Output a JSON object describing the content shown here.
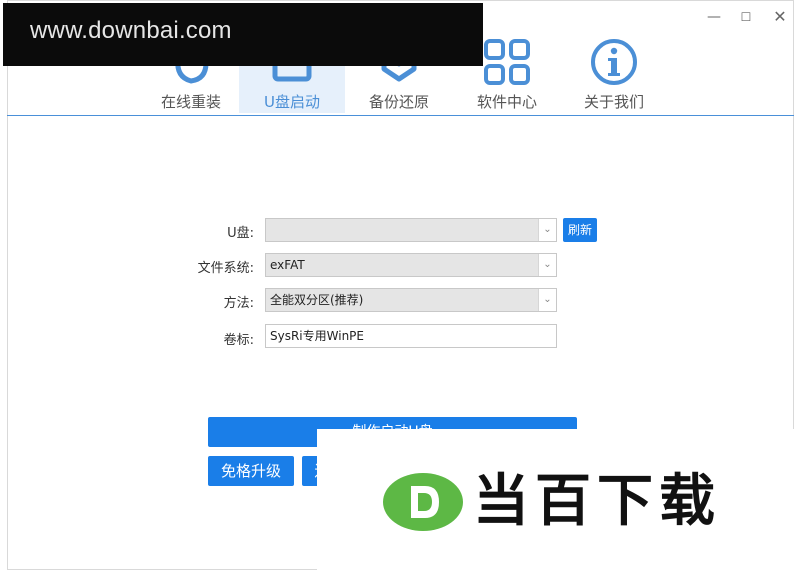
{
  "watermark_top": "www.downbai.com",
  "watermark_bottom": {
    "text": "当百下载"
  },
  "window_controls": {
    "min": "—",
    "max": "☐",
    "close": "✕"
  },
  "nav": {
    "items": [
      {
        "label": "在线重装",
        "icon": "cursor-hand-icon",
        "active": false
      },
      {
        "label": "U盘启动",
        "icon": "usb-drive-icon",
        "active": true
      },
      {
        "label": "备份还原",
        "icon": "backup-box-icon",
        "active": false
      },
      {
        "label": "软件中心",
        "icon": "grid-apps-icon",
        "active": false
      },
      {
        "label": "关于我们",
        "icon": "info-icon",
        "active": false
      }
    ]
  },
  "form": {
    "usb": {
      "label": "U盘:",
      "value": ""
    },
    "filesystem": {
      "label": "文件系统:",
      "value": "exFAT"
    },
    "method": {
      "label": "方法:",
      "value": "全能双分区(推荐)"
    },
    "volume": {
      "label": "卷标:",
      "value": "SysRi专用WinPE"
    },
    "refresh_label": "刷新"
  },
  "actions": {
    "make_label": "制作启动U盘",
    "upgrade_label": "免格升级",
    "second_label": "还"
  },
  "colors": {
    "accent": "#1a7ee8",
    "active_tab_bg": "#e6f0fb",
    "active_tab_text": "#4b8fd6"
  }
}
